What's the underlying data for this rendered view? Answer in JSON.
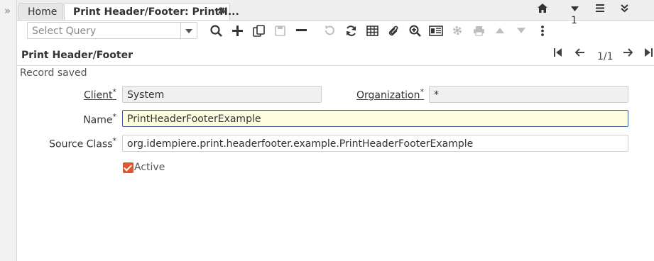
{
  "sidebar": {
    "expand_glyph": "»"
  },
  "tabs": {
    "home_label": "Home",
    "active_label": "Print Header/Footer: PrintH...",
    "close_glyph": "✖"
  },
  "window_tools": {
    "home_icon": "home-icon",
    "menu_count": "1"
  },
  "toolbar": {
    "query_placeholder": "Select Query",
    "icons": [
      "search-icon",
      "add-icon",
      "copy-icon",
      "save-icon",
      "delete-icon",
      "undo-icon",
      "refresh-icon",
      "grid-toggle-icon",
      "attachment-icon",
      "zoom-icon",
      "report-icon",
      "process-icon",
      "print-icon",
      "previous-icon",
      "next-icon",
      "more-icon"
    ]
  },
  "window": {
    "title": "Print Header/Footer",
    "record_position": "1/1",
    "status": "Record saved"
  },
  "form": {
    "client_label": "Client",
    "client_value": "System",
    "org_label": "Organization",
    "org_value": "*",
    "name_label": "Name",
    "name_value": "PrintHeaderFooterExample",
    "source_class_label": "Source Class",
    "source_class_value": "org.idempiere.print.headerfooter.example.PrintHeaderFooterExample",
    "active_label": "Active",
    "active_checked": true,
    "required_mark": "*"
  },
  "colors": {
    "accent": "#e4542b",
    "required_border": "#3a5a97",
    "required_bg": "#fffde0"
  }
}
